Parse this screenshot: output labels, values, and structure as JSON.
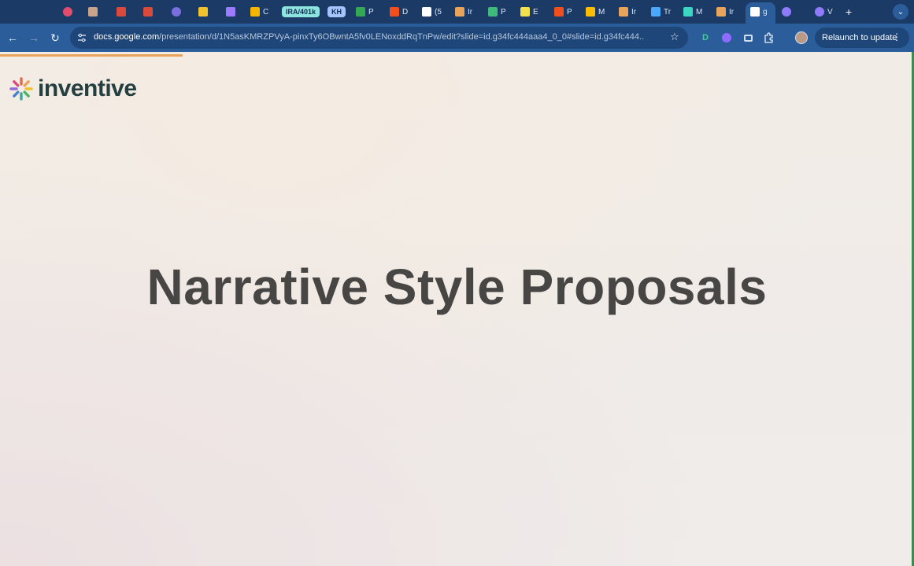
{
  "browser": {
    "tabs": [
      {
        "label": "",
        "icon": "record-icon",
        "color": "#e24d6f"
      },
      {
        "label": "",
        "icon": "avatar-icon",
        "color": "#c9a48a"
      },
      {
        "label": "",
        "icon": "gmail-icon",
        "color": "#d94a3c"
      },
      {
        "label": "",
        "icon": "gmail-icon",
        "color": "#d94a3c"
      },
      {
        "label": "",
        "icon": "circle-icon",
        "color": "#7b6fe0"
      },
      {
        "label": "",
        "icon": "calendar-icon",
        "color": "#f2c12e"
      },
      {
        "label": "",
        "icon": "x-icon",
        "color": "#9b7bff"
      },
      {
        "label": "C",
        "icon": "slides-icon",
        "color": "#f4b400"
      },
      {
        "label": "IRA/401k",
        "icon": "pill",
        "color": "#8ee5e0"
      },
      {
        "label": "KH",
        "icon": "pill",
        "color": "#a8c4ff"
      },
      {
        "label": "P",
        "icon": "sheets-icon",
        "color": "#34a853"
      },
      {
        "label": "D",
        "icon": "figma-icon",
        "color": "#f24e1e"
      },
      {
        "label": "(5",
        "icon": "notion-icon",
        "color": "#ffffff"
      },
      {
        "label": "Ir",
        "icon": "inventive-icon",
        "color": "#e8a45a"
      },
      {
        "label": "P",
        "icon": "stack-icon",
        "color": "#3fb97c"
      },
      {
        "label": "E",
        "icon": "sparkle-icon",
        "color": "#f2e14b"
      },
      {
        "label": "P",
        "icon": "figma-icon",
        "color": "#f24e1e"
      },
      {
        "label": "M",
        "icon": "drive-icon",
        "color": "#fbbc04"
      },
      {
        "label": "Ir",
        "icon": "inventive-icon",
        "color": "#e8a45a"
      },
      {
        "label": "Tr",
        "icon": "arrow-icon",
        "color": "#4aa8ff"
      },
      {
        "label": "M",
        "icon": "square-icon",
        "color": "#3dd6c3"
      },
      {
        "label": "Ir",
        "icon": "inventive-icon",
        "color": "#e8a45a"
      },
      {
        "label": "g",
        "icon": "close-icon",
        "color": "#ffffff"
      },
      {
        "label": "",
        "icon": "gear-icon",
        "color": "#8f7bff"
      },
      {
        "label": "V",
        "icon": "gear-icon",
        "color": "#8f7bff"
      }
    ],
    "new_tab": "+",
    "url_host": "docs.google.com",
    "url_path": "/presentation/d/1N5asKMRZPVyA-pinxTy6OBwntA5fv0LENoxddRqTnPw/edit?slide=id.g34fc444aaa4_0_0#slide=id.g34fc444...",
    "relaunch_label": "Relaunch to update"
  },
  "slide": {
    "logo_text": "inventive",
    "title": "Narrative Style Proposals",
    "progress_percent": 20
  }
}
